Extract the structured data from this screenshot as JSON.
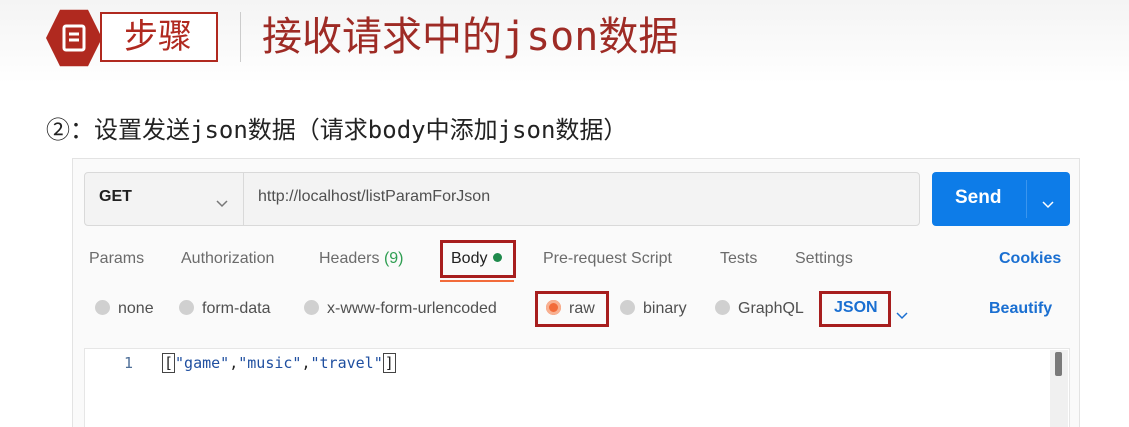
{
  "header": {
    "step_label": "步骤",
    "title": "接收请求中的json数据"
  },
  "subtitle": "②：设置发送json数据（请求body中添加json数据）",
  "request": {
    "method": "GET",
    "url": "http://localhost/listParamForJson",
    "send_label": "Send"
  },
  "tabs": {
    "params": "Params",
    "authorization": "Authorization",
    "headers": "Headers",
    "headers_count": "(9)",
    "body": "Body",
    "prerequest": "Pre-request Script",
    "tests": "Tests",
    "settings": "Settings",
    "cookies": "Cookies"
  },
  "body_types": {
    "none": "none",
    "form_data": "form-data",
    "urlencoded": "x-www-form-urlencoded",
    "raw": "raw",
    "binary": "binary",
    "graphql": "GraphQL",
    "selected": "raw"
  },
  "format": {
    "selected": "JSON",
    "beautify": "Beautify"
  },
  "editor": {
    "line_number": "1",
    "open_bracket": "[",
    "s1": "\"game\"",
    "c1": ",",
    "s2": "\"music\"",
    "c2": ",",
    "s3": "\"travel\"",
    "close_bracket": "]"
  },
  "colors": {
    "brand_red": "#b0291f",
    "send_blue": "#0d7ce8",
    "link_blue": "#1a6fd1",
    "accent_orange": "#f26b3a",
    "status_green": "#1f8a4c"
  }
}
